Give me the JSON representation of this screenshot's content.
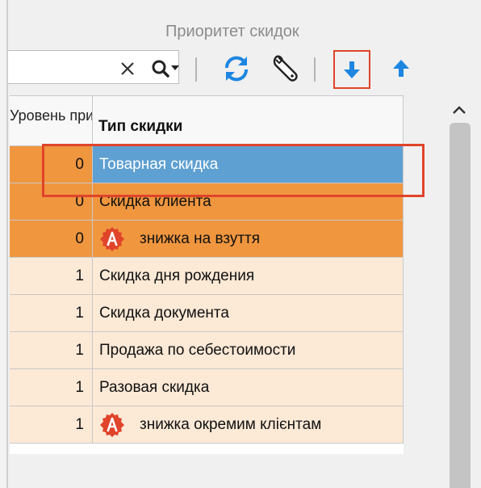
{
  "panel": {
    "title": "Приоритет скидок"
  },
  "toolbar": {
    "search_value": "",
    "icons": [
      "close-icon",
      "search-dropdown-icon",
      "refresh-icon",
      "wrench-icon",
      "arrow-down-icon",
      "arrow-up-icon"
    ]
  },
  "table": {
    "columns": {
      "level": "Уровень приоритета",
      "type": "Тип скидки"
    },
    "rows": [
      {
        "level": "0",
        "type": "Товарная скидка",
        "selected": true,
        "badge": false
      },
      {
        "level": "0",
        "type": "Скидка клиента",
        "selected": false,
        "badge": false
      },
      {
        "level": "0",
        "type": "знижка на взуття",
        "selected": false,
        "badge": true
      },
      {
        "level": "1",
        "type": "Скидка дня рождения",
        "selected": false,
        "badge": false
      },
      {
        "level": "1",
        "type": "Скидка документа",
        "selected": false,
        "badge": false
      },
      {
        "level": "1",
        "type": "Продажа по себестоимости",
        "selected": false,
        "badge": false
      },
      {
        "level": "1",
        "type": "Разовая скидка",
        "selected": false,
        "badge": false
      },
      {
        "level": "1",
        "type": "знижка  окремим клієнтам",
        "selected": false,
        "badge": true
      }
    ]
  },
  "colors": {
    "priority_0_row": "#f0963f",
    "priority_1_row": "#fce9d6",
    "selected_cell": "#5fa0d2",
    "accent_blue": "#1e86e0",
    "highlight_frame": "#e0442a",
    "badge_red": "#e0442a"
  }
}
